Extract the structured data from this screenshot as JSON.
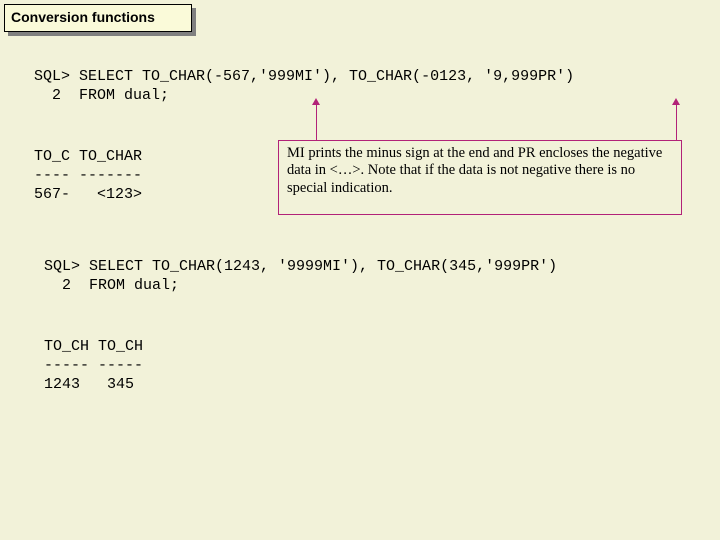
{
  "title": "Conversion functions",
  "sql1_line1": "SQL> SELECT TO_CHAR(-567,'999MI'), TO_CHAR(-0123, '9,999PR')",
  "sql1_line2": "  2  FROM dual;",
  "result1": "TO_C TO_CHAR\n---- -------\n567-   <123>",
  "note": "MI prints the minus sign at the end and PR encloses the negative data in <…>.  Note that if the data is not negative there is no special indication.",
  "sql2_line1": "SQL> SELECT TO_CHAR(1243, '9999MI'), TO_CHAR(345,'999PR')",
  "sql2_line2": "  2  FROM dual;",
  "result2": "TO_CH TO_CH\n----- -----\n1243   345"
}
